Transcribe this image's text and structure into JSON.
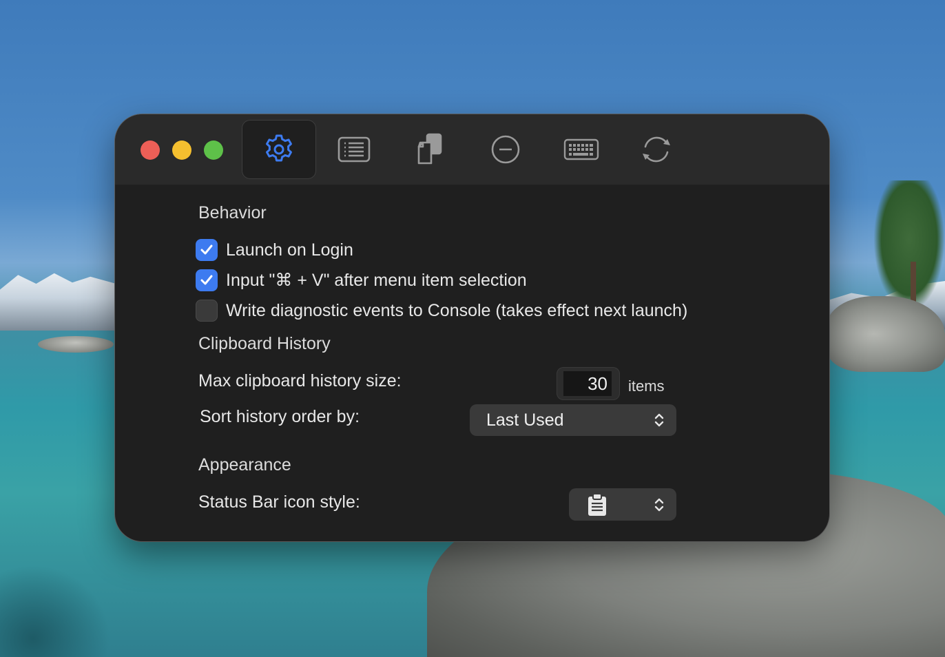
{
  "window": {
    "tabs": [
      {
        "name": "general",
        "icon": "gear-icon",
        "active": true
      },
      {
        "name": "menu",
        "icon": "list-icon",
        "active": false
      },
      {
        "name": "type",
        "icon": "documents-icon",
        "active": false
      },
      {
        "name": "exclude",
        "icon": "minus-circle-icon",
        "active": false
      },
      {
        "name": "shortcuts",
        "icon": "keyboard-icon",
        "active": false
      },
      {
        "name": "updates",
        "icon": "sync-icon",
        "active": false
      }
    ]
  },
  "behavior": {
    "title": "Behavior",
    "launch_on_login": {
      "label": "Launch on Login",
      "checked": true
    },
    "input_paste": {
      "label": "Input \"⌘ + V\" after menu item selection",
      "checked": true
    },
    "diagnostics": {
      "label": "Write diagnostic events to Console (takes effect next launch)",
      "checked": false
    }
  },
  "history": {
    "title": "Clipboard History",
    "max_size_label": "Max clipboard history size:",
    "max_size_value": "30",
    "max_size_unit": "items",
    "sort_label": "Sort history order by:",
    "sort_value": "Last Used"
  },
  "appearance": {
    "title": "Appearance",
    "icon_style_label": "Status Bar icon style:",
    "icon_style_value_icon": "clipboard-icon"
  },
  "colors": {
    "accent": "#3d7bf0",
    "window_bg": "#1f1f1f",
    "toolbar_bg": "#2a2a2a",
    "close": "#ed5f57",
    "minimize": "#f5bf2f",
    "maximize": "#5ec149"
  }
}
